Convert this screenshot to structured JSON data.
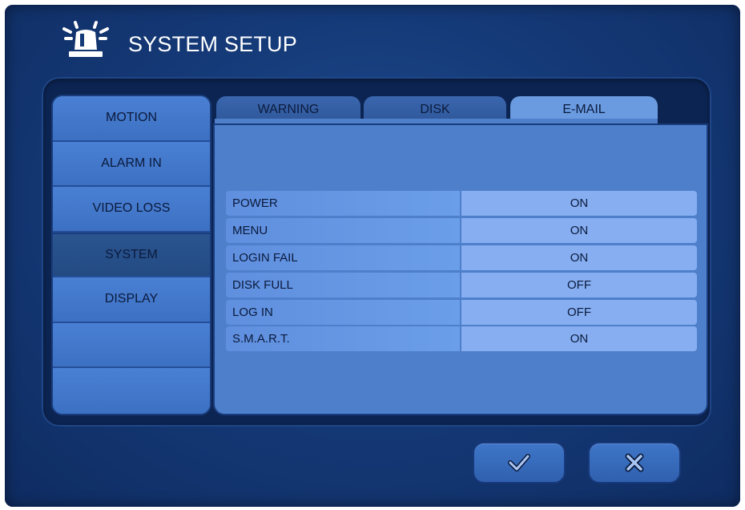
{
  "window": {
    "title": "SYSTEM SETUP",
    "icon": "siren-icon"
  },
  "sidebar": {
    "items": [
      {
        "label": "MOTION",
        "active": false
      },
      {
        "label": "ALARM IN",
        "active": false
      },
      {
        "label": "VIDEO LOSS",
        "active": false
      },
      {
        "label": "SYSTEM",
        "active": true
      },
      {
        "label": "DISPLAY",
        "active": false
      },
      {
        "label": "",
        "active": false
      },
      {
        "label": "",
        "active": false
      }
    ]
  },
  "tabs": [
    {
      "label": "WARNING",
      "active": false
    },
    {
      "label": "DISK",
      "active": false
    },
    {
      "label": "E-MAIL",
      "active": true
    }
  ],
  "settings": [
    {
      "label": "POWER",
      "value": "ON"
    },
    {
      "label": "MENU",
      "value": "ON"
    },
    {
      "label": "LOGIN FAIL",
      "value": "ON"
    },
    {
      "label": "DISK FULL",
      "value": "OFF"
    },
    {
      "label": "LOG IN",
      "value": "OFF"
    },
    {
      "label": "S.M.A.R.T.",
      "value": "ON"
    }
  ],
  "buttons": {
    "confirm_icon": "checkmark-icon",
    "cancel_icon": "close-icon"
  },
  "colors": {
    "background": "#153a78",
    "panel": "#0c2452",
    "accent": "#6a9be0",
    "value_cell": "#86aef0"
  }
}
